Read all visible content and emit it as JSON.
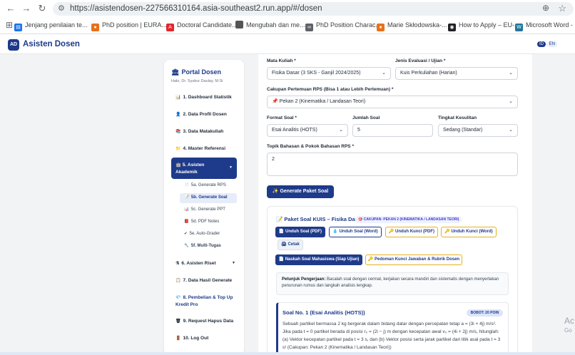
{
  "browser": {
    "url": "https://asistendosen-227566310164.asia-southeast2.run.app/#/dosen",
    "bookmarks": [
      {
        "label": "Jenjang penilaian te...",
        "icon": "doc-icon",
        "color": "#1a73e8"
      },
      {
        "label": "PhD position | EURA...",
        "icon": "people-icon",
        "color": "#e8711a"
      },
      {
        "label": "Doctoral Candidate...",
        "icon": "abb-icon",
        "color": "#e3262a"
      },
      {
        "label": "Mengubah dan me...",
        "icon": "apple-icon",
        "color": "#555555"
      },
      {
        "label": "PhD Position Charac...",
        "icon": "glasses-icon",
        "color": "#5f6368"
      },
      {
        "label": "Marie Skłodowska-...",
        "icon": "people-icon",
        "color": "#e8711a"
      },
      {
        "label": "How to Apply – EU-...",
        "icon": "globe-icon",
        "color": "#202124"
      },
      {
        "label": "Microsoft Word - IT",
        "icon": "wp-icon",
        "color": "#21759b"
      }
    ]
  },
  "app": {
    "logo": "AD",
    "title": "Asisten Dosen",
    "lang_active": "ID",
    "lang_other": "EN"
  },
  "sidebar": {
    "title": "Portal Dosen",
    "greeting": "Halo, Dr. Syukur Daulay, M.Si",
    "menu": [
      {
        "label": "1. Dashboard Statistik",
        "icon": "chart-icon"
      },
      {
        "label": "2. Data Profil Dosen",
        "icon": "user-icon"
      },
      {
        "label": "3. Data Matakuliah",
        "icon": "books-icon"
      },
      {
        "label": "4. Master Referensi",
        "icon": "folder-icon"
      },
      {
        "label": "5. Asisten Akademik",
        "icon": "robot-icon"
      },
      {
        "label": "6. Asisten Riset",
        "icon": "flask-icon"
      },
      {
        "label": "7. Data Hasil Generate",
        "icon": "clipboard-icon"
      },
      {
        "label": "8. Pembelian & Top Up Kredit Pro",
        "icon": "diamond-icon"
      },
      {
        "label": "9. Request Hapus Data",
        "icon": "trash-icon"
      },
      {
        "label": "10. Log Out",
        "icon": "door-icon"
      }
    ],
    "submenu": [
      {
        "label": "5a. Generate RPS",
        "icon": "doc-icon"
      },
      {
        "label": "5b. Generate Soal",
        "icon": "pencil-icon"
      },
      {
        "label": "5c. Generate PPT",
        "icon": "slides-icon"
      },
      {
        "label": "5d. PDF Notes",
        "icon": "note-icon"
      },
      {
        "label": "5e. Auto-Grader",
        "icon": "check-icon"
      },
      {
        "label": "5f. Multi-Tugas",
        "icon": "tools-icon"
      }
    ]
  },
  "form": {
    "mata_kuliah_label": "Mata Kuliah *",
    "mata_kuliah_value": "Fisika Dasar (3 SKS - Ganjil 2024/2025)",
    "jenis_label": "Jenis Evaluasi / Ujian *",
    "jenis_value": "Kuis Perkuliahan (Harian)",
    "cakupan_label": "Cakupan Pertemuan RPS (Bisa 1 atau Lebih Pertemuan) *",
    "cakupan_value": "📌 Pekan 2 (Kinematika / Landasan Teori)",
    "format_label": "Format Soal *",
    "format_value": "Esai Analitis (HOTS)",
    "jumlah_label": "Jumlah Soal",
    "jumlah_value": "5",
    "tingkat_label": "Tingkat Kesulitan",
    "tingkat_value": "Sedang (Standar)",
    "topik_label": "Topik Bahasan & Pokok Bahasan RPS *",
    "topik_value": "2",
    "generate_label": "✨ Generate Paket Soal"
  },
  "result": {
    "title": "📝 Paket Soal KUIS – Fisika Dasar",
    "badge": "🎯 CAKUPAN: PEKAN 2 (KINEMATIKA / LANDASAN TEORI)",
    "btn_pdf": "📄 Unduh Soal (PDF)",
    "btn_word": "💧 Unduh Soal (Word)",
    "btn_kunci_pdf": "🔑 Unduh Kunci (PDF)",
    "btn_kunci_word": "🔑 Unduh Kunci (Word)",
    "btn_cetak": "🖨 Cetak",
    "tab_naskah": "📄 Naskah Soal Mahasiswa (Siap Ujian)",
    "tab_pedoman": "🔑 Pedoman Kunci Jawaban & Rubrik Dosen",
    "petunjuk_label": "Petunjuk Pengerjaan:",
    "petunjuk_text": " Bacalah soal dengan cermat, kerjakan secara mandiri dan sistematis dengan menyertakan penurunan rumus dan langkah analisis lengkap.",
    "q1_title": "Soal No. 1 (Esai Analitis (HOTS))",
    "q1_bobot": "BOBOT: 20 POIN",
    "q1_text": "Sebuah partikel bermassa 2 kg bergerak dalam bidang datar dengan percepatan tetap a = (3i + 4j) m/s². Jika pada t = 0 partikel berada di posisi r₀ = (2i − j) m dengan kecepatan awal v₀ = (4i + 2j) m/s, hitunglah: (a) Vektor kecepatan partikel pada t = 3 s, dan (b) Vektor posisi serta jarak partikel dari titik asal pada t = 3 s! (Cakupan: Pekan 2 (Kinematika / Landasan Teori))"
  },
  "watermark": {
    "line1": "Ac",
    "line2": "Go"
  }
}
